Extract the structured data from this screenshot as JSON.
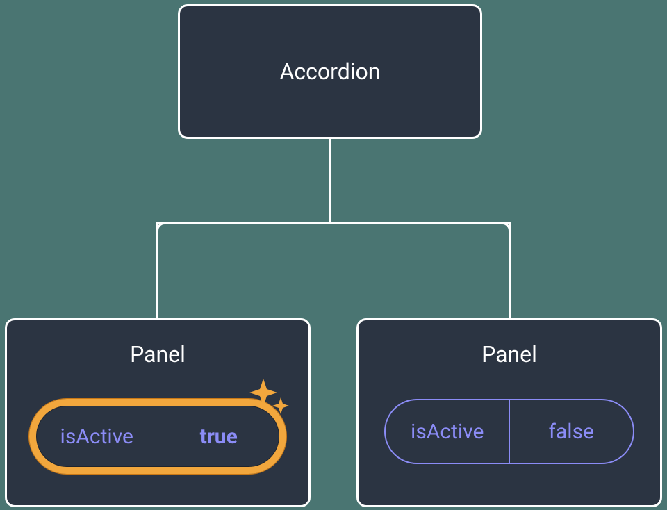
{
  "diagram": {
    "root": {
      "label": "Accordion"
    },
    "panels": [
      {
        "label": "Panel",
        "propName": "isActive",
        "propValue": "true",
        "highlighted": true
      },
      {
        "label": "Panel",
        "propName": "isActive",
        "propValue": "false",
        "highlighted": false
      }
    ]
  }
}
